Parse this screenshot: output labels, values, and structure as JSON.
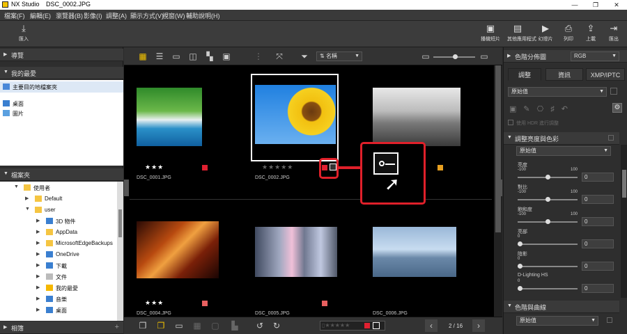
{
  "window": {
    "app_name": "NX Studio",
    "file_name": "DSC_0002.JPG",
    "minimize": "—",
    "maximize": "❐",
    "close": "✕"
  },
  "menu": [
    "檔案(F)",
    "編輯(E)",
    "瀏覽器(B)",
    "影像(I)",
    "調整(A)",
    "顯示方式(V)",
    "視窗(W)",
    "輔助說明(H)"
  ],
  "toolbar": {
    "import_label": "匯入",
    "right": [
      {
        "label": "播機短片",
        "icon": "slideshow-clip-icon"
      },
      {
        "label": "其他應用程式",
        "icon": "apps-icon"
      },
      {
        "label": "幻燈片",
        "icon": "slideshow-icon"
      },
      {
        "label": "列印",
        "icon": "print-icon"
      },
      {
        "label": "上載",
        "icon": "upload-icon"
      },
      {
        "label": "匯出",
        "icon": "export-icon"
      }
    ]
  },
  "left_panel": {
    "browse": "導覽",
    "favorites": "我的最愛",
    "fav_items": [
      "主要目的地檔案夾",
      "桌面",
      "圖片"
    ],
    "folders": "檔案夾",
    "tree": [
      {
        "label": "使用者",
        "indent": 1,
        "open": true
      },
      {
        "label": "Default",
        "indent": 2,
        "open": false
      },
      {
        "label": "user",
        "indent": 2,
        "open": true
      },
      {
        "label": "3D 物件",
        "indent": 3,
        "open": false
      },
      {
        "label": "AppData",
        "indent": 3,
        "open": false
      },
      {
        "label": "MicrosoftEdgeBackups",
        "indent": 3,
        "open": false
      },
      {
        "label": "OneDrive",
        "indent": 3,
        "open": false
      },
      {
        "label": "下載",
        "indent": 3,
        "open": false
      },
      {
        "label": "文件",
        "indent": 3,
        "open": false
      },
      {
        "label": "我的最愛",
        "indent": 3,
        "open": false
      },
      {
        "label": "音樂",
        "indent": 3,
        "open": false
      },
      {
        "label": "桌面",
        "indent": 3,
        "open": false
      }
    ],
    "albums": "相簿"
  },
  "center": {
    "sort_label": "名稱",
    "page": "2 / 16",
    "thumbs": [
      {
        "name": "DSC_0001.JPG",
        "stars": "★★★",
        "label_color": "#e02030",
        "label_num": "1"
      },
      {
        "name": "DSC_0002.JPG",
        "stars": "★★★★★",
        "label_color": "#e02030",
        "label_num": "1"
      },
      {
        "name": "",
        "stars": "",
        "label_color": "#e8a020",
        "label_num": "3"
      },
      {
        "name": "DSC_0004.JPG",
        "stars": "★★★",
        "label_color": "#e86060",
        "label_num": "2"
      },
      {
        "name": "DSC_0005.JPG",
        "stars": "",
        "label_color": "#e86060",
        "label_num": "2"
      },
      {
        "name": "DSC_0006.JPG",
        "stars": "",
        "label_color": "#e86060",
        "label_num": "2"
      }
    ]
  },
  "right_panel": {
    "histogram": "色階分佈圖",
    "histogram_mode": "RGB",
    "tabs": [
      "調整",
      "資訊",
      "XMP/IPTC"
    ],
    "preset": "原始值",
    "hdr_label": "使用 HDR 進行調整",
    "section1": "調整亮度與色彩",
    "section1_preset": "原始值",
    "sliders": [
      {
        "label": "亮度",
        "min": "-100",
        "max": "100",
        "value": "0",
        "pos": 0.5
      },
      {
        "label": "對比",
        "min": "-100",
        "max": "100",
        "value": "0",
        "pos": 0.5
      },
      {
        "label": "飽和度",
        "min": "-100",
        "max": "100",
        "value": "0",
        "pos": 0.5
      },
      {
        "label": "亮部",
        "min": "0",
        "max": "",
        "value": "0",
        "pos": 0.0
      },
      {
        "label": "陰影",
        "min": "0",
        "max": "",
        "value": "0",
        "pos": 0.0
      },
      {
        "label": "D-Lighting HS",
        "min": "0",
        "max": "",
        "value": "0",
        "pos": 0.0
      }
    ],
    "section2": "色階與曲線",
    "section2_preset": "原始值"
  }
}
